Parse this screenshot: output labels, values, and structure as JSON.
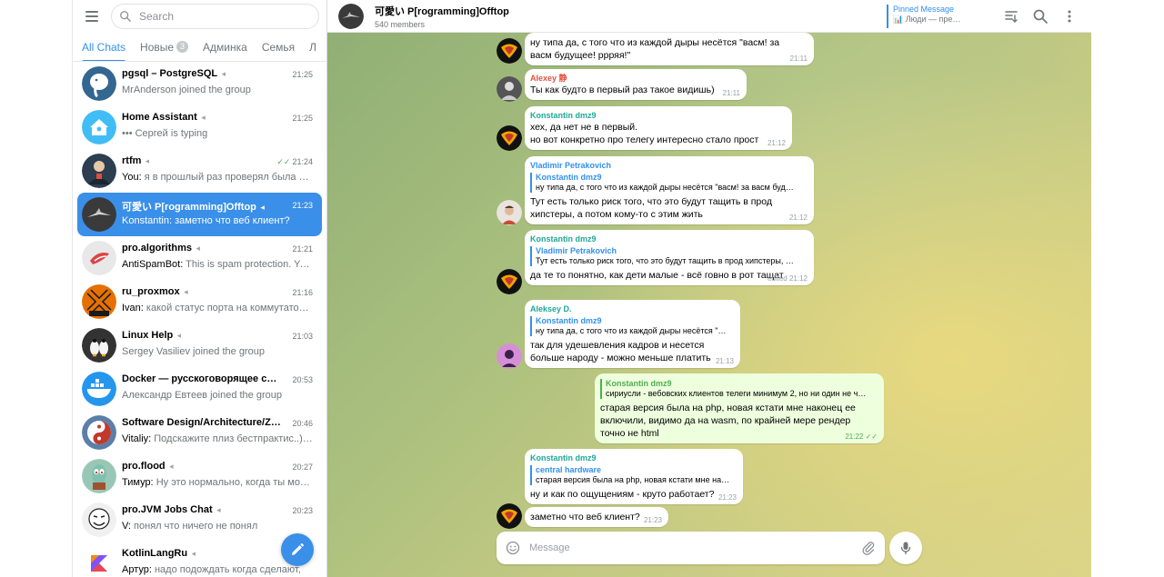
{
  "sidebar": {
    "search": {
      "placeholder": "Search"
    },
    "tabs": [
      {
        "label": "All Chats",
        "active": true
      },
      {
        "label": "Новые",
        "badge": "3"
      },
      {
        "label": "Админка"
      },
      {
        "label": "Семья"
      },
      {
        "label": "Л"
      }
    ],
    "chats": [
      {
        "title": "pgsql – PostgreSQL",
        "time": "21:25",
        "sender": "",
        "preview": "MrAnderson joined the group",
        "avatar": "elephant-icon",
        "avatar_color": "#336791"
      },
      {
        "title": "Home Assistant",
        "time": "21:25",
        "sender": "",
        "preview": "••• Сергей is typing",
        "avatar": "home-icon",
        "avatar_color": "#41bdf5"
      },
      {
        "title": "rtfm",
        "time": "21:24",
        "sender": "You: ",
        "preview": "я в прошлый раз проверял была ст…",
        "avatar": "portrait-icon",
        "avatar_color": "#2c3e50",
        "read": true
      },
      {
        "title": "可愛い P[rogramming]Offtop",
        "time": "21:23",
        "sender": "Konstantin: ",
        "preview": "заметно что веб клиент?",
        "avatar": "plane-icon",
        "avatar_color": "#3a3a3a",
        "active": true
      },
      {
        "title": "pro.algorithms",
        "time": "21:21",
        "sender": "AntiSpamBot: ",
        "preview": "This is spam protection. You…",
        "avatar": "bird-icon",
        "avatar_color": "#e8e8e8"
      },
      {
        "title": "ru_proxmox",
        "time": "21:16",
        "sender": "Ivan: ",
        "preview": "какой статус порта на коммутатор…",
        "avatar": "proxmox-icon",
        "avatar_color": "#e57000"
      },
      {
        "title": "Linux Help",
        "time": "21:03",
        "sender": "",
        "preview": "Sergey Vasiliev joined the group",
        "avatar": "penguin-icon",
        "avatar_color": "#333333"
      },
      {
        "title": "Docker — русскоговорящее сооб…",
        "time": "20:53",
        "sender": "",
        "preview": "Александр Евтеев joined the group",
        "avatar": "whale-icon",
        "avatar_color": "#2496ed"
      },
      {
        "title": "Software Design/Architecture/Zen",
        "time": "20:46",
        "sender": "Vitaliy: ",
        "preview": "Подскажите плиз бестпрактис..) …",
        "avatar": "yin-yang-icon",
        "avatar_color": "#5b7fa8"
      },
      {
        "title": "pro.flood",
        "time": "20:27",
        "sender": "Тимур: ",
        "preview": "Ну это нормально, когда ты мож…",
        "avatar": "squidward-icon",
        "avatar_color": "#9ac7b5"
      },
      {
        "title": "pro.JVM Jobs Chat",
        "time": "20:23",
        "sender": "V: ",
        "preview": "понял что ничего не понял",
        "avatar": "meme-face-icon",
        "avatar_color": "#f0f0f0"
      },
      {
        "title": "KotlinLangRu",
        "time": "",
        "sender": "Артур: ",
        "preview": "надо подождать когда сделают,",
        "avatar": "kotlin-icon",
        "avatar_color": "#ffffff"
      }
    ]
  },
  "header": {
    "title": "可愛い P[rogramming]Offtop",
    "members": "540 members",
    "pinned_label": "Pinned Message",
    "pinned_text": "📊 Люди — пре…"
  },
  "messages": [
    {
      "sender": "",
      "text": "ну типа да, с того что из каждой дыры несётся \"васм! за\nвасм будущее! ррряя!\"",
      "time": "21:11"
    },
    {
      "sender": "Alexey 静",
      "sender_color": "#e0533f",
      "text": "Ты как будто в первый раз такое видишь)",
      "time": "21:11"
    },
    {
      "sender": "Konstantin dmz9",
      "sender_color": "#1fa89a",
      "text": "хех, да нет не в первый.\nно вот конкретно про телегу интересно стало прост",
      "time": "21:12"
    },
    {
      "sender": "Vladimir Petrakovich",
      "sender_color": "#3390ec",
      "reply_name": "Konstantin dmz9",
      "reply_text": "ну типа да, с того что из каждой дыры несётся \"васм! за васм буд…",
      "text": "Тут есть только риск того, что это будут тащить в прод\nхипстеры, а потом кому-то с этим жить",
      "time": "21:12"
    },
    {
      "sender": "Konstantin dmz9",
      "sender_color": "#1fa89a",
      "reply_name": "Vladimir Petrakovich",
      "reply_text": "Тут есть только риск того, что это будут тащить в прод хипстеры, …",
      "text": "да те то понятно, как дети малые - всё говно в рот тащат",
      "time": "edited 21:12"
    },
    {
      "sender": "Aleksey D.",
      "sender_color": "#1fa89a",
      "reply_name": "Konstantin dmz9",
      "reply_text": "ну типа да, с того что из каждой дыры несётся \"…",
      "text": "так для удешевления кадров и несется\nбольше народу - можно меньше платить",
      "time": "21:13"
    },
    {
      "sender": "",
      "reply_name": "Konstantin dmz9",
      "reply_text": "сириусли - вебовских клиентов телеги минимум 2, но ни один не ч…",
      "text": "старая версия была на php, новая кстати  мне наконец ее\nвключили, видимо да на wasm, по крайней мере рендер\nточно не html",
      "time": "21:22 ✓✓"
    },
    {
      "sender": "Konstantin dmz9",
      "sender_color": "#1fa89a",
      "reply_name": "central hardware",
      "reply_text": "старая версия была на php, новая кстати мне на…",
      "text": "ну и как по ощущениям - круто работает?",
      "time": "21:23"
    },
    {
      "sender": "",
      "text": "заметно что веб клиент?",
      "time": "21:23"
    }
  ],
  "composer": {
    "placeholder": "Message"
  }
}
